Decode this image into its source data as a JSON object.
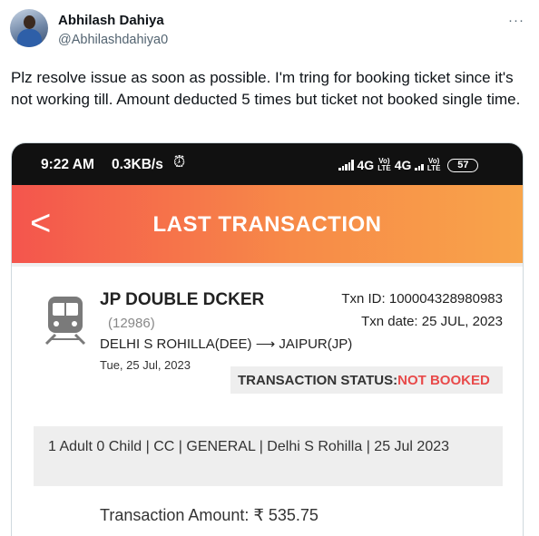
{
  "tweet": {
    "author_name": "Abhilash Dahiya",
    "author_handle": "@Abhilashdahiya0",
    "more_glyph": "···",
    "text": "Plz resolve issue as soon as possible. I'm tring for booking ticket since it's not working till. Amount deducted 5 times but ticket not booked single time."
  },
  "screenshot": {
    "status_bar": {
      "time": "9:22 AM",
      "speed": "0.3KB/s",
      "alarm_icon": "alarm-icon",
      "network_1": "4G",
      "network_2": "4G",
      "volte_label_line1": "Vo)",
      "volte_label_line2": "LTE",
      "battery": "57"
    },
    "header": {
      "back_glyph": "<",
      "title": "LAST TRANSACTION"
    },
    "transaction": {
      "train_name": "JP DOUBLE DCKER",
      "train_number": "(12986)",
      "route_from": "DELHI S ROHILLA(DEE)",
      "route_arrow": "⟶",
      "route_to": "JAIPUR(JP)",
      "journey_date": "Tue, 25 Jul, 2023",
      "txn_id": "Txn ID: 100004328980983",
      "txn_date": "Txn date: 25 JUL, 2023",
      "status_label": "TRANSACTION STATUS:",
      "status_value": "NOT BOOKED",
      "details": "1 Adult 0 Child  | CC | GENERAL | Delhi S Rohilla | 25 Jul 2023",
      "amount_label": "Transaction Amount:",
      "amount_value": "₹ 535.75"
    },
    "colors": {
      "header_gradient_start": "#f4554d",
      "header_gradient_end": "#f8a44a",
      "status_not_booked": "#e84a4a"
    }
  }
}
